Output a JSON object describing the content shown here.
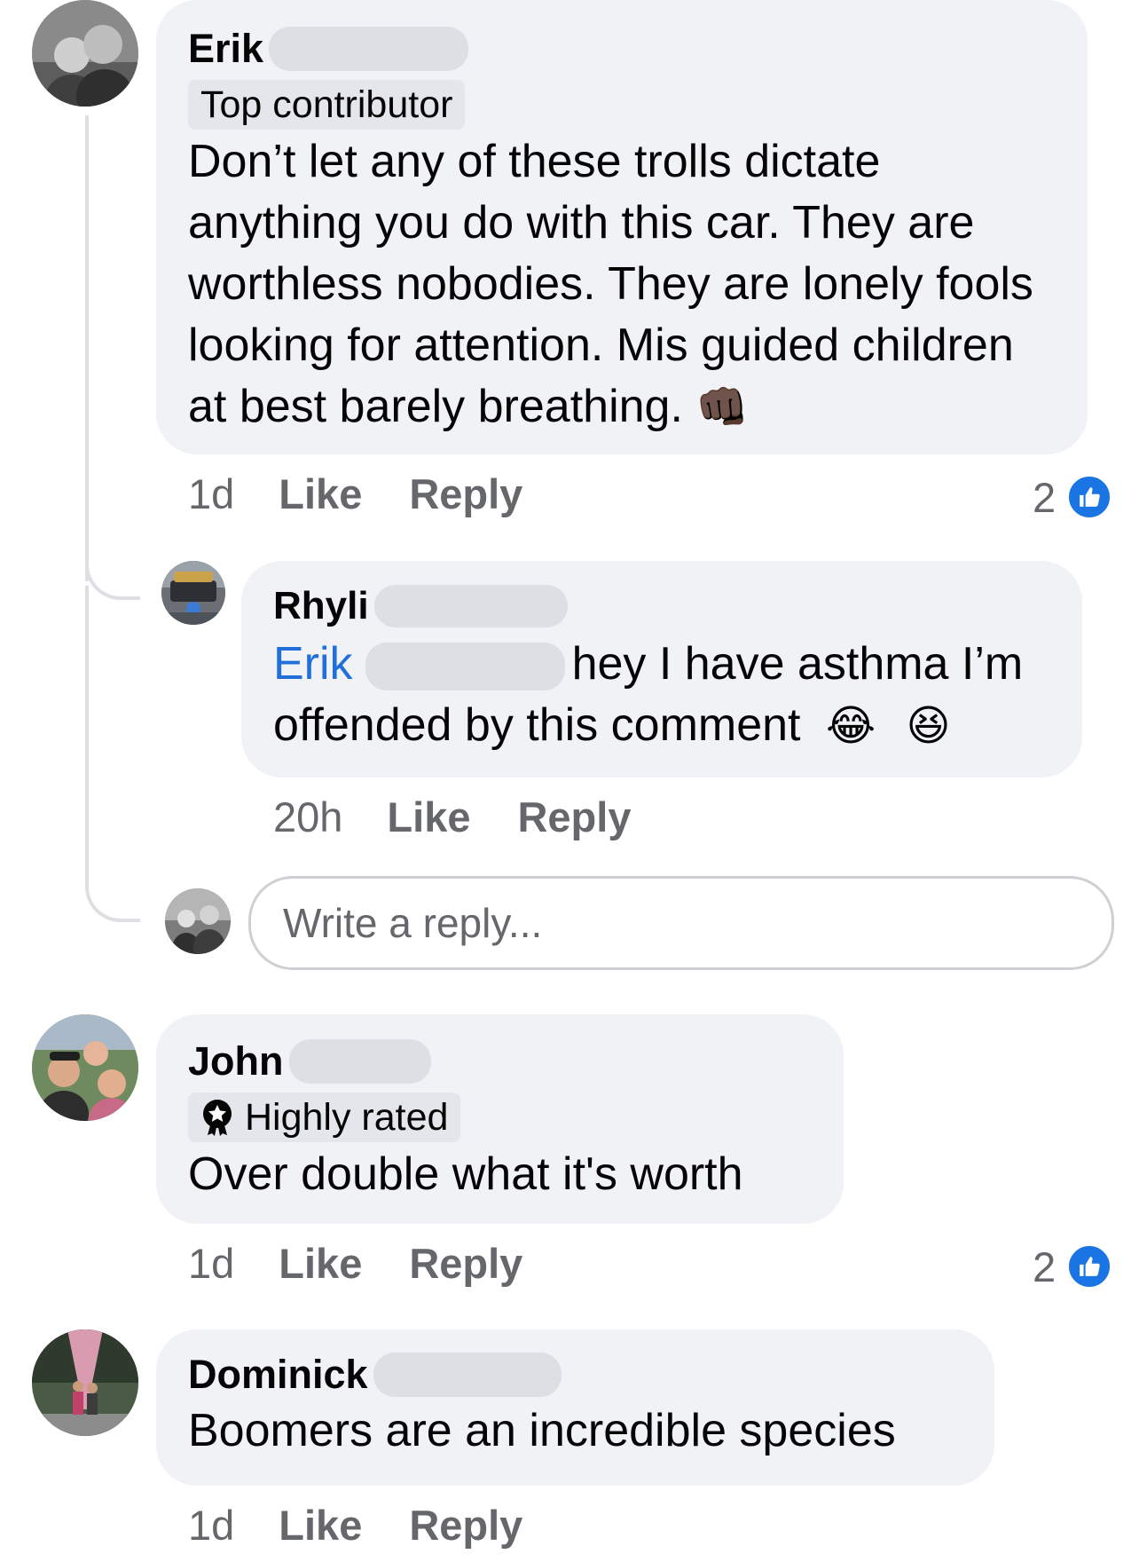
{
  "comments": [
    {
      "author": "Erik",
      "badge": "Top contributor",
      "text": "Don’t let any of these trolls dictate anything you do with this car. They are worthless nobodies. They are lonely fools looking for attention. Mis guided children at best barely breathing.",
      "emoji": "👊🏿",
      "time": "1d",
      "like_label": "Like",
      "reply_label": "Reply",
      "reaction_count": "2",
      "replies": [
        {
          "author": "Rhyli",
          "mention": "Erik",
          "text_line1": "hey I have asthma I’m",
          "text_line2": "offended by this comment",
          "emoji1": "😂",
          "emoji2": "😆",
          "time": "20h",
          "like_label": "Like",
          "reply_label": "Reply"
        }
      ]
    },
    {
      "author": "John",
      "badge": "Highly rated",
      "text": "Over double what it's worth",
      "time": "1d",
      "like_label": "Like",
      "reply_label": "Reply",
      "reaction_count": "2"
    },
    {
      "author": "Dominick",
      "text": "Boomers are an incredible species",
      "time": "1d",
      "like_label": "Like",
      "reply_label": "Reply"
    }
  ],
  "reply_box": {
    "placeholder": "Write a reply..."
  },
  "colors": {
    "bubble": "#f0f2f5",
    "mention": "#216fdb",
    "like_blue": "#1b74e4",
    "meta_gray": "#65676b"
  }
}
